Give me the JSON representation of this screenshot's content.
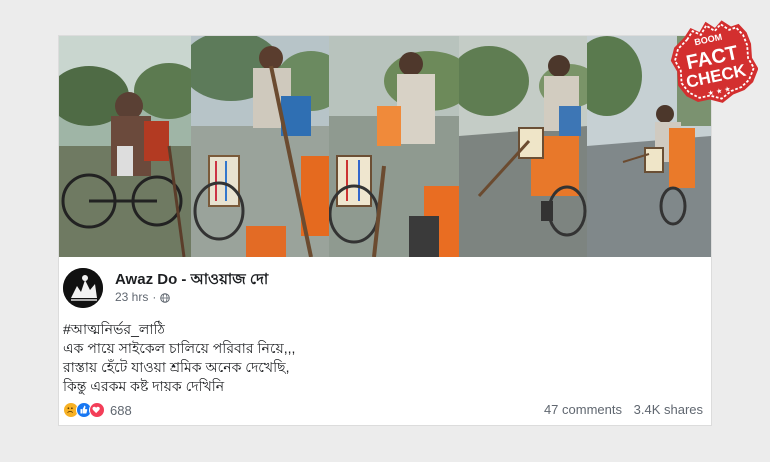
{
  "post": {
    "page_name": "Awaz Do - আওয়াজ দো",
    "time": "23 hrs",
    "dot": "·",
    "lines": [
      "#আত্মনির্ভর_লাঠি",
      "এক পায়ে সাইকেল চালিয়ে পরিবার নিয়ে,,,",
      "রাস্তায় হেঁটে যাওয়া শ্রমিক অনেক দেখেছি,",
      "কিন্তু এরকম কষ্ট দায়ক দেখিনি"
    ]
  },
  "engagement": {
    "reaction_count": "688",
    "comments": "47 comments",
    "shares": "3.4K shares"
  },
  "badge": {
    "top": "BOOM",
    "line1": "FACT",
    "line2": "CHECK",
    "stars": "★ ★ ★"
  },
  "colors": {
    "badge_red": "#d32f2f",
    "sad_yellow": "#f7b125",
    "like_blue": "#1877f2",
    "love_red": "#f33e58"
  }
}
